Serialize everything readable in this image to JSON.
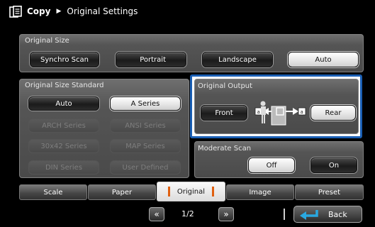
{
  "header": {
    "app_name": "Copy",
    "separator": "▶",
    "page_title": "Original Settings"
  },
  "original_size": {
    "label": "Original Size",
    "options": [
      "Synchro Scan",
      "Portrait",
      "Landscape",
      "Auto"
    ],
    "selected": "Auto"
  },
  "size_standard": {
    "label": "Original Size Standard",
    "options": [
      "Auto",
      "A Series",
      "ARCH Series",
      "ANSI Series",
      "30x42 Series",
      "MAP Series",
      "DIN Series",
      "User Defined"
    ],
    "selected": "A Series"
  },
  "original_output": {
    "label": "Original Output",
    "front": "Front",
    "rear": "Rear",
    "selected": "Rear"
  },
  "moderate_scan": {
    "label": "Moderate Scan",
    "off": "Off",
    "on": "On",
    "selected": "Off"
  },
  "tabs": [
    "Scale",
    "Paper",
    "Original",
    "Image",
    "Preset"
  ],
  "active_tab": "Original",
  "pager": {
    "prev": "«",
    "page": "1/2",
    "next": "»"
  },
  "back": {
    "label": "Back"
  },
  "colors": {
    "accent_blue": "#1a5fb4",
    "tab_marker": "#e06010",
    "back_icon": "#29a8e0"
  }
}
